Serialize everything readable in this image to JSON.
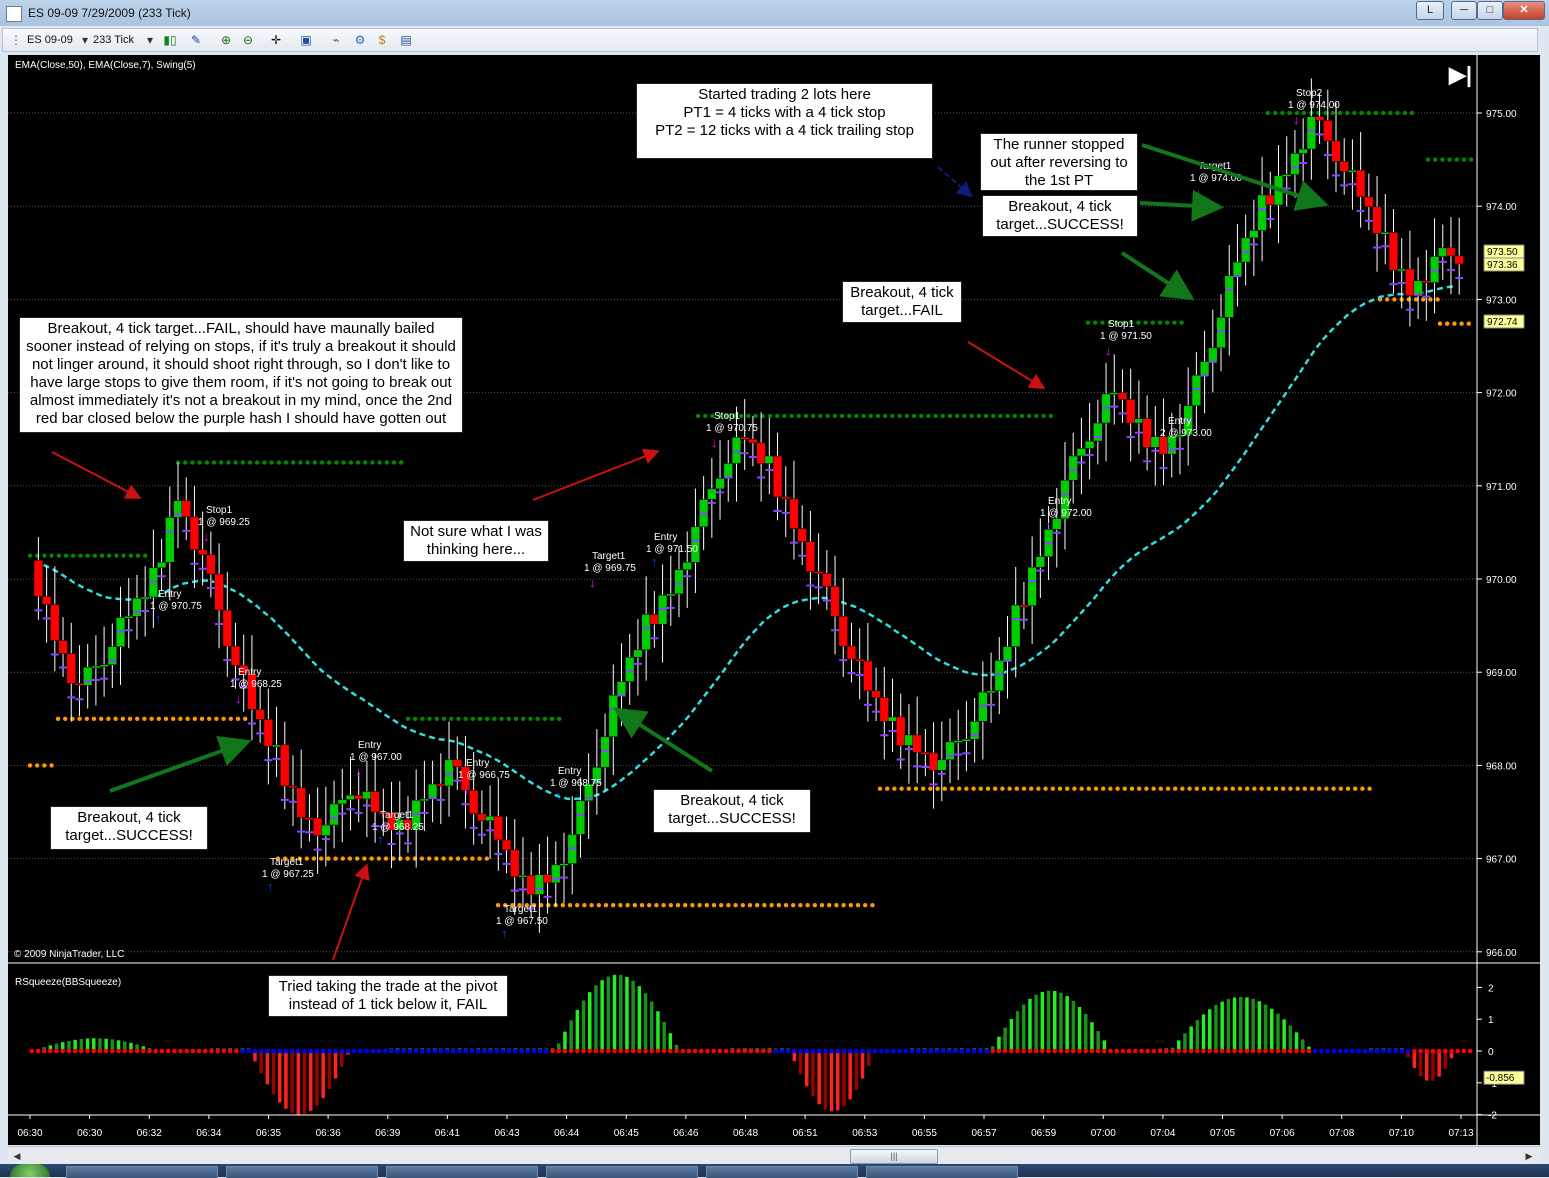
{
  "window": {
    "title": "ES 09-09  7/29/2009 (233 Tick)",
    "buttons": {
      "help": "L",
      "minimize": "─",
      "maximize": "□",
      "close": "✕"
    }
  },
  "toolbar": {
    "instrument": "ES 09-09",
    "interval": "233 Tick",
    "icons": [
      "bar-type-icon",
      "draw-pencil-icon",
      "zoom-in-icon",
      "zoom-out-icon",
      "crosshair-icon",
      "chart-properties-icon",
      "indicators-icon",
      "strategies-icon",
      "money-icon",
      "data-box-icon"
    ]
  },
  "chart": {
    "indicator_label": "EMA(Close,50), EMA(Close,7), Swing(5)",
    "copyright": "© 2009 NinjaTrader, LLC",
    "jump_to_end": "▶|",
    "price_labels": [
      "975.00",
      "974.00",
      "973.00",
      "972.00",
      "971.00",
      "970.00",
      "969.00",
      "968.00",
      "967.00",
      "966.00"
    ],
    "badges": [
      {
        "text": "973.50",
        "color": "#ffff99"
      },
      {
        "text": "973.36",
        "color": "#ffff99"
      },
      {
        "text": "972.74",
        "color": "#ffff99"
      }
    ],
    "time_labels": [
      "06:30",
      "06:30",
      "06:32",
      "06:34",
      "06:35",
      "06:36",
      "06:39",
      "06:41",
      "06:43",
      "06:44",
      "06:45",
      "06:46",
      "06:48",
      "06:51",
      "06:53",
      "06:55",
      "06:57",
      "06:59",
      "07:00",
      "07:04",
      "07:05",
      "07:06",
      "07:08",
      "07:10",
      "07:13"
    ],
    "colors": {
      "up": "#00cc00",
      "down": "#ff0000",
      "ema_fast": "#8844ff",
      "ema_slow": "#33dddd",
      "swing_high": "#008800",
      "swing_low": "#ff9900",
      "long_arrow": "#0044ff",
      "short_arrow": "#ff00ff"
    }
  },
  "trade_labels": [
    {
      "top": "Stop1",
      "bottom": "1 @ 969.25"
    },
    {
      "top": "Entry",
      "bottom": "1 @ 970.75"
    },
    {
      "top": "Entry",
      "bottom": "1 @ 968.25"
    },
    {
      "top": "Target1",
      "bottom": "1 @ 967.25"
    },
    {
      "top": "Entry",
      "bottom": "1 @ 967.00"
    },
    {
      "top": "Target1",
      "bottom": "1 @ 968.25"
    },
    {
      "top": "Entry",
      "bottom": "1 @ 966.75"
    },
    {
      "top": "Target1",
      "bottom": "1 @ 967.50"
    },
    {
      "top": "Entry",
      "bottom": "1 @ 968.75"
    },
    {
      "top": "Target1",
      "bottom": "1 @ 969.75"
    },
    {
      "top": "Entry",
      "bottom": "1 @ 971.50"
    },
    {
      "top": "Stop1",
      "bottom": "1 @ 970.75"
    },
    {
      "top": "Entry",
      "bottom": "1 @ 972.00"
    },
    {
      "top": "Stop1",
      "bottom": "1 @ 971.50"
    },
    {
      "top": "Entry",
      "bottom": "2 @ 973.00"
    },
    {
      "top": "Target1",
      "bottom": "1 @ 974.00"
    },
    {
      "top": "Stop2",
      "bottom": "1 @ 974.00"
    }
  ],
  "annotations": [
    {
      "text": "Started trading 2 lots here\nPT1 = 4 ticks with a 4 tick stop\nPT2 = 12 ticks with a 4 tick trailing stop"
    },
    {
      "text": "The runner stopped\nout after reversing to\nthe 1st PT"
    },
    {
      "text": "Breakout, 4 tick\ntarget...SUCCESS!"
    },
    {
      "text": "Breakout, 4 tick\ntarget...FAIL"
    },
    {
      "text": "Breakout, 4 tick target...FAIL, should have maunally bailed\nsooner instead of relying on stops, if it's truly a breakout it should\nnot linger around, it should shoot right through, so I don't like to\nhave large stops to give them room, if it's not going to break out\nalmost immediately it's not a breakout in my mind, once the 2nd\nred bar closed below the purple hash I should have gotten out"
    },
    {
      "text": "Not sure what I was\nthinking here..."
    },
    {
      "text": "Breakout, 4 tick\ntarget...SUCCESS!"
    },
    {
      "text": "Breakout, 4 tick\ntarget...SUCCESS!"
    },
    {
      "text": "Tried taking the trade at the pivot\ninstead of 1 tick below it, FAIL"
    }
  ],
  "lower_panel": {
    "indicator_label": "RSqueeze(BBSqueeze)",
    "axis_labels": [
      "2",
      "1",
      "0",
      "-1",
      "-2"
    ],
    "badge": "-0.856"
  },
  "scrollbar": {
    "grip": "|||"
  },
  "chart_data": {
    "type": "candlestick",
    "instrument": "ES 09-09",
    "interval": "233 Tick",
    "ylim": [
      966.0,
      975.25
    ],
    "trades": [
      {
        "label": "Entry",
        "qty": 1,
        "price": 970.75
      },
      {
        "label": "Stop1",
        "qty": 1,
        "price": 969.25
      },
      {
        "label": "Entry",
        "qty": 1,
        "price": 968.25
      },
      {
        "label": "Target1",
        "qty": 1,
        "price": 967.25
      },
      {
        "label": "Entry",
        "qty": 1,
        "price": 967.0
      },
      {
        "label": "Target1",
        "qty": 1,
        "price": 968.25
      },
      {
        "label": "Entry",
        "qty": 1,
        "price": 966.75
      },
      {
        "label": "Target1",
        "qty": 1,
        "price": 967.5
      },
      {
        "label": "Entry",
        "qty": 1,
        "price": 968.75
      },
      {
        "label": "Target1",
        "qty": 1,
        "price": 969.75
      },
      {
        "label": "Entry",
        "qty": 1,
        "price": 971.5
      },
      {
        "label": "Stop1",
        "qty": 1,
        "price": 970.75
      },
      {
        "label": "Entry",
        "qty": 1,
        "price": 972.0
      },
      {
        "label": "Stop1",
        "qty": 1,
        "price": 971.5
      },
      {
        "label": "Entry",
        "qty": 2,
        "price": 973.0
      },
      {
        "label": "Target1",
        "qty": 1,
        "price": 974.0
      },
      {
        "label": "Stop2",
        "qty": 1,
        "price": 974.0
      }
    ],
    "last_values": {
      "price_badges": [
        973.5,
        973.36
      ],
      "ema_slow": 972.74,
      "squeeze": -0.856
    },
    "close_path": [
      970.2,
      969.4,
      968.8,
      969.2,
      969.6,
      970.0,
      970.9,
      970.2,
      969.4,
      968.6,
      968.1,
      967.5,
      967.3,
      967.8,
      967.5,
      967.3,
      967.7,
      968.0,
      967.6,
      967.2,
      966.7,
      966.8,
      967.2,
      968.1,
      968.9,
      969.5,
      969.9,
      970.5,
      971.2,
      971.5,
      971.2,
      970.6,
      970.0,
      969.4,
      968.8,
      968.4,
      968.2,
      968.0,
      968.4,
      968.8,
      969.6,
      970.3,
      971.0,
      971.6,
      972.0,
      971.6,
      971.4,
      971.8,
      972.6,
      973.4,
      974.0,
      974.4,
      974.9,
      974.6,
      974.1,
      973.6,
      973.1,
      973.4,
      973.5
    ]
  }
}
